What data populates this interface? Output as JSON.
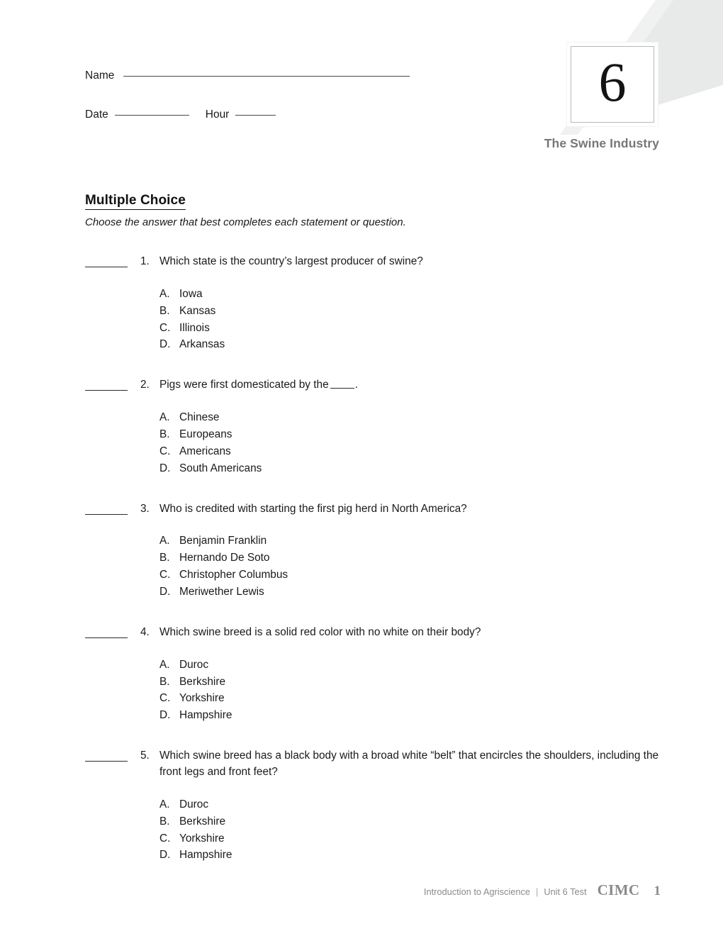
{
  "header": {
    "name_label": "Name",
    "date_label": "Date",
    "hour_label": "Hour",
    "unit_number": "6",
    "unit_title": "The Swine Industry"
  },
  "section": {
    "title": "Multiple Choice",
    "instructions": "Choose the answer that best completes each statement or question."
  },
  "questions": [
    {
      "number": "1.",
      "text": "Which state is the country’s largest producer of swine?",
      "options": [
        {
          "letter": "A.",
          "text": "Iowa"
        },
        {
          "letter": "B.",
          "text": "Kansas"
        },
        {
          "letter": "C.",
          "text": "Illinois"
        },
        {
          "letter": "D.",
          "text": "Arkansas"
        }
      ]
    },
    {
      "number": "2.",
      "text_before_blank": "Pigs were first domesticated by the",
      "text_after_blank": ".",
      "options": [
        {
          "letter": "A.",
          "text": "Chinese"
        },
        {
          "letter": "B.",
          "text": "Europeans"
        },
        {
          "letter": "C.",
          "text": "Americans"
        },
        {
          "letter": "D.",
          "text": "South Americans"
        }
      ]
    },
    {
      "number": "3.",
      "text": "Who is credited with starting the first pig herd in North America?",
      "options": [
        {
          "letter": "A.",
          "text": "Benjamin Franklin"
        },
        {
          "letter": "B.",
          "text": "Hernando De Soto"
        },
        {
          "letter": "C.",
          "text": "Christopher Columbus"
        },
        {
          "letter": "D.",
          "text": "Meriwether Lewis"
        }
      ]
    },
    {
      "number": "4.",
      "text": "Which swine breed is a solid red color with no white on their body?",
      "options": [
        {
          "letter": "A.",
          "text": "Duroc"
        },
        {
          "letter": "B.",
          "text": "Berkshire"
        },
        {
          "letter": "C.",
          "text": "Yorkshire"
        },
        {
          "letter": "D.",
          "text": "Hampshire"
        }
      ]
    },
    {
      "number": "5.",
      "text": "Which swine breed has a black body with a broad white “belt” that encircles the shoulders, including the front legs and front feet?",
      "options": [
        {
          "letter": "A.",
          "text": "Duroc"
        },
        {
          "letter": "B.",
          "text": "Berkshire"
        },
        {
          "letter": "C.",
          "text": "Yorkshire"
        },
        {
          "letter": "D.",
          "text": "Hampshire"
        }
      ]
    }
  ],
  "footer": {
    "course": "Introduction to Agriscience",
    "separator": "|",
    "unit": "Unit 6 Test",
    "brand": "CIMC",
    "page": "1"
  },
  "colors": {
    "text": "#1a1a1a",
    "muted": "#8a8a8a",
    "deco_gray": "#e8eaea",
    "rule": "#4a4a4a"
  }
}
